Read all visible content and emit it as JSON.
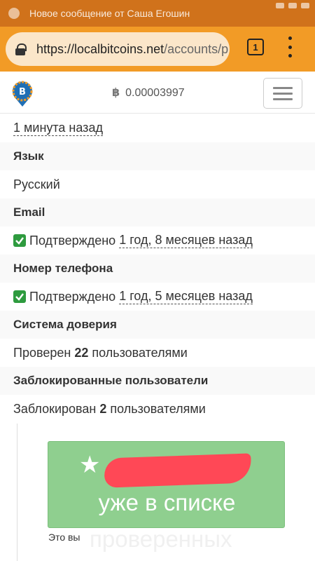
{
  "status_bar": {
    "notification": "Новое сообщение от Саша Егошин"
  },
  "browser": {
    "url_host": "https://localbitcoins.net",
    "url_path": "/accounts/p",
    "tab_count": "1"
  },
  "header": {
    "btc_symbol": "฿",
    "balance": "0.00003997"
  },
  "profile": {
    "last_seen": "1 минута назад",
    "language_label": "Язык",
    "language_value": "Русский",
    "email_label": "Email",
    "email_status": "Подтверждено",
    "email_time": "1 год, 8 месяцев назад",
    "phone_label": "Номер телефона",
    "phone_status": "Подтверждено",
    "phone_time": "1 год, 5 месяцев назад",
    "trust_label": "Система доверия",
    "trust_prefix": "Проверен",
    "trust_count": "22",
    "trust_suffix": "пользователями",
    "blocked_label": "Заблокированные пользователи",
    "blocked_prefix": "Заблокирован",
    "blocked_count": "2",
    "blocked_suffix": "пользователями"
  },
  "card": {
    "line1": "уже в списке",
    "line2": "проверенных",
    "small": "Это вы"
  },
  "colors": {
    "status_bar": "#d0721b",
    "toolbar": "#f29b26",
    "check": "#2e9b3f",
    "card": "#8fcf8f"
  }
}
